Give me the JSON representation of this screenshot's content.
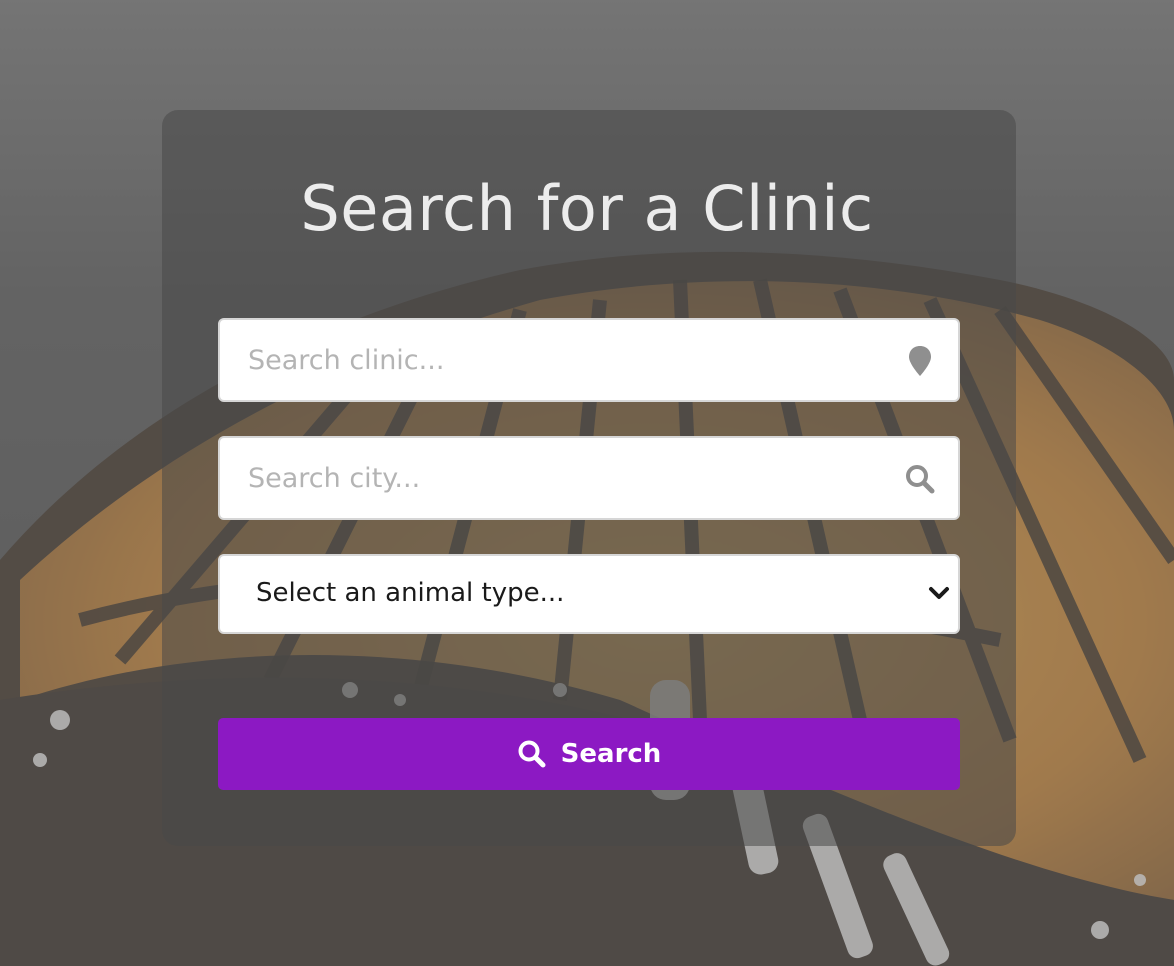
{
  "header": {
    "title": "Search for a Clinic"
  },
  "form": {
    "clinic_placeholder": "Search clinic...",
    "clinic_icon": "map-marker-icon",
    "city_placeholder": "Search city...",
    "city_icon": "search-icon",
    "animal_select_value": "Select an animal type...",
    "animal_select_icon": "chevron-down-icon",
    "search_button_label": "Search",
    "search_button_icon": "search-icon"
  },
  "colors": {
    "button": "#8c19c3",
    "card": "#484848",
    "title": "#ececec",
    "placeholder": "#b4b4b4"
  },
  "background": {
    "description_icon": "butterfly-wing-image"
  }
}
